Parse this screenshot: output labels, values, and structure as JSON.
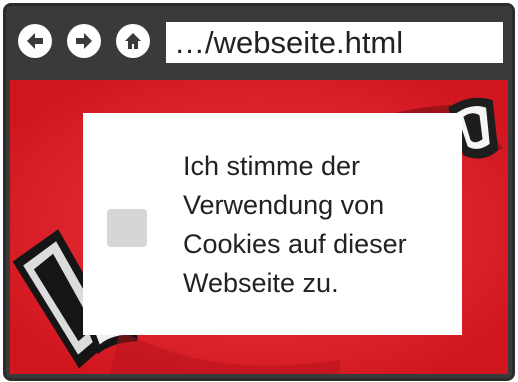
{
  "browser": {
    "address": "…/webseite.html",
    "icons": {
      "back": "arrow-left-icon",
      "forward": "arrow-right-icon",
      "home": "home-icon"
    }
  },
  "consent": {
    "text": "Ich stimme der\nVerwendung von\nCookies auf dieser\nWebseite zu.",
    "checked": false
  },
  "colors": {
    "frame": "#3a3a3a",
    "page_background": "#e8202a",
    "dialog": "#ffffff",
    "checkbox": "#d6d6d6"
  }
}
